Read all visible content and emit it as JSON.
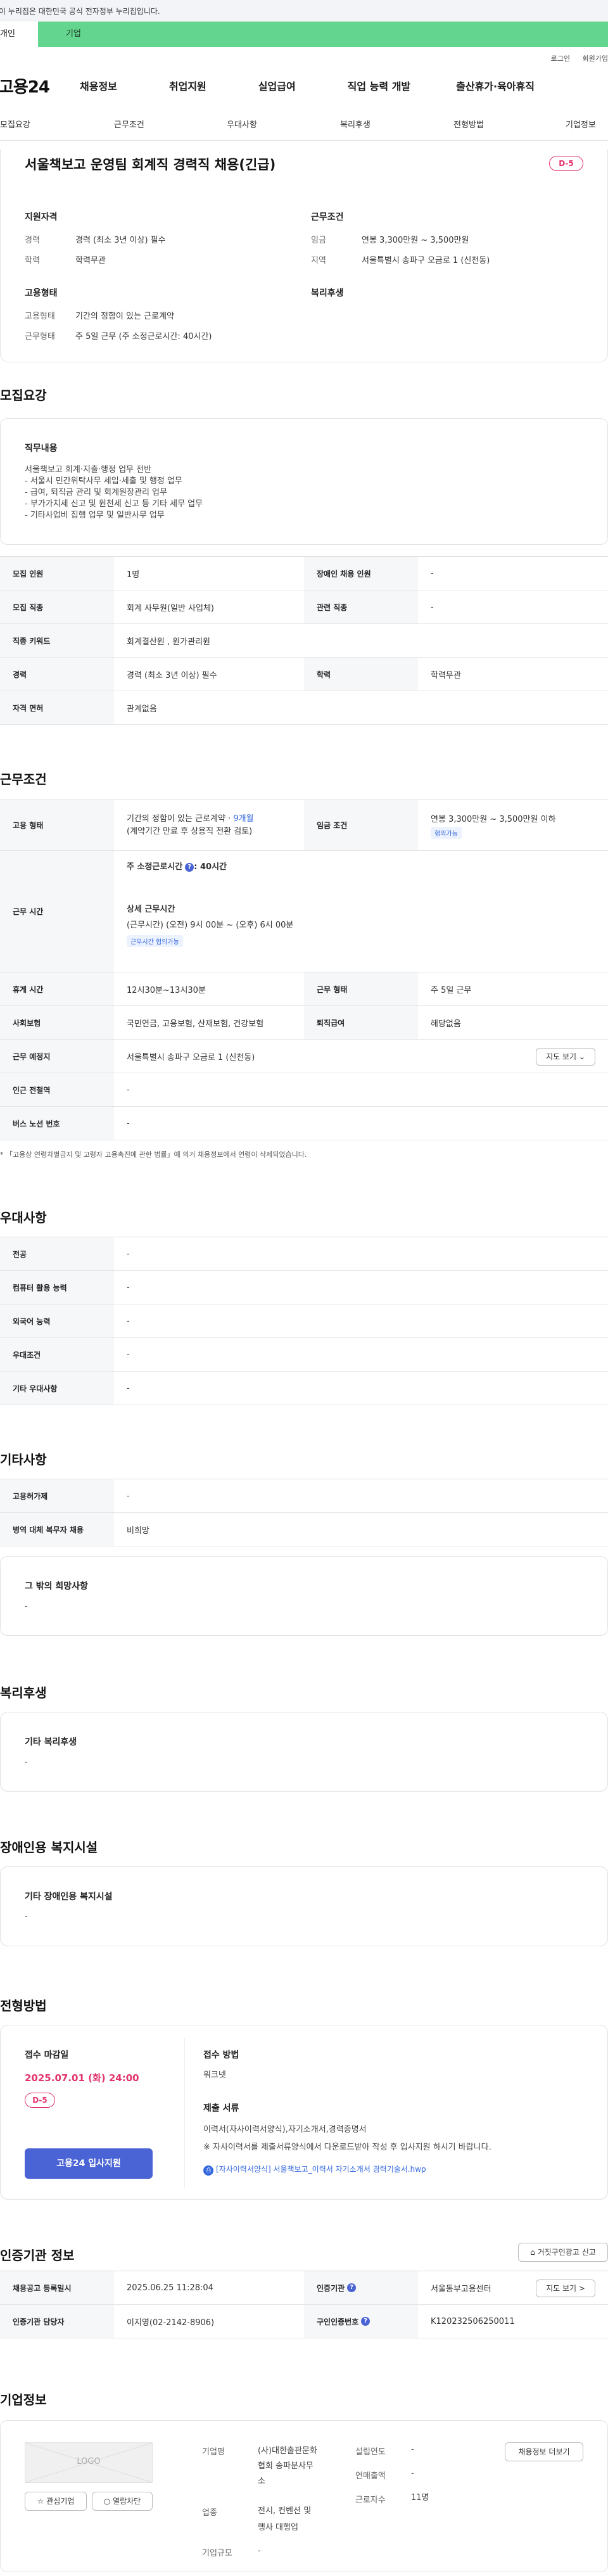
{
  "gov_banner": "이 누리집은 대한민국 공식 전자정부 누리집입니다.",
  "tabs": {
    "personal": "개인",
    "corp": "기업"
  },
  "util": {
    "login": "로그인",
    "join": "회원가입"
  },
  "logo": "고용24",
  "gnb": [
    "채용정보",
    "취업지원",
    "실업급여",
    "직업 능력 개발",
    "출산휴가·육아휴직"
  ],
  "anchors": [
    "모집요강",
    "근무조건",
    "우대사항",
    "복리후생",
    "전형방법",
    "기업정보"
  ],
  "summary": {
    "title": "서울책보고 운영팀 회계직 경력직 채용(긴급)",
    "dday": "D-5",
    "qual_head": "지원자격",
    "career_label": "경력",
    "career_val": "경력 (최소 3년 이상) 필수",
    "edu_label": "학력",
    "edu_val": "학력무관",
    "cond_head": "근무조건",
    "wage_label": "임금",
    "wage_val": "연봉 3,300만원 ~ 3,500만원",
    "region_label": "지역",
    "region_val": "서울특별시 송파구 오금로 1 (신천동)",
    "emp_head": "고용형태",
    "emptype_label": "고용형태",
    "emptype_val": "기간의 정함이 있는 근로계약",
    "hours_label": "근무형태",
    "hours_val": "주 5일 근무 (주 소정근로시간: 40시간)",
    "welfare_head": "복리후생"
  },
  "recruit": {
    "title": "모집요강",
    "duty_head": "직무내용",
    "duty_lines": [
      "서울책보고 회계·지출·행정 업무 전반",
      "- 서울시 민간위탁사무 세입·세출 및 행정 업무",
      "- 급여, 퇴직금 관리 및 회계원장관리 업무",
      "- 부가가치세 신고 및 원천세 신고 등 기타 세무 업무",
      "- 기타사업비 집행 업무 및 일반사무 업무"
    ],
    "rows": [
      {
        "l1": "모집 인원",
        "v1": "1명",
        "l2": "장애인 채용 인원",
        "v2": "-"
      },
      {
        "l1": "모집 직종",
        "v1": "회계 사무원(일반 사업체)",
        "l2": "관련 직종",
        "v2": "-"
      },
      {
        "l1": "직종 키워드",
        "v1": "회계결산원 , 원가관리원"
      },
      {
        "l1": "경력",
        "v1": "경력 (최소 3년 이상) 필수",
        "l2": "학력",
        "v2": "학력무관"
      },
      {
        "l1": "자격 면허",
        "v1": "관계없음"
      }
    ]
  },
  "work": {
    "title": "근무조건",
    "emptype_label": "고용 형태",
    "emptype_line1": "기간의 정함이 있는 근로계약 · ",
    "emptype_months": "9개월",
    "emptype_line2": "(계약기간 만료 후 상용직 전환 검토)",
    "wage_label": "임금 조건",
    "wage_val": "연봉 3,300만원 ~ 3,500만원 이하",
    "wage_tag": "협의가능",
    "hours_label": "근무 시간",
    "week_hours": "주 소정근로시간",
    "week_hours_val": ": 40시간",
    "detail_head": "상세 근무시간",
    "detail_val": "(근무시간) (오전) 9시 00분 ~ (오후) 6시 00분",
    "detail_tag": "근무시간 협의가능",
    "rest_label": "휴게 시간",
    "rest_val": "12시30분~13시30분",
    "worktype_label": "근무 형태",
    "worktype_val": "주 5일 근무",
    "ins_label": "사회보험",
    "ins_val": "국민연금, 고용보험, 산재보험, 건강보험",
    "retire_label": "퇴직급여",
    "retire_val": "해당없음",
    "place_label": "근무 예정지",
    "place_val": "서울특별시 송파구 오금로 1 (신천동)",
    "map_btn": "지도 보기 ⌄",
    "subway_label": "인근 전철역",
    "subway_val": "-",
    "bus_label": "버스 노선 번호",
    "bus_val": "-",
    "footnote": "* 「고용상 연령차별금지 및 고령자 고용촉진에 관한 법률」에 의거 채용정보에서 연령이 삭제되었습니다."
  },
  "pref": {
    "title": "우대사항",
    "rows": [
      {
        "label": "전공",
        "val": "-"
      },
      {
        "label": "컴퓨터 활용 능력",
        "val": "-"
      },
      {
        "label": "외국어 능력",
        "val": "-"
      },
      {
        "label": "우대조건",
        "val": "-"
      },
      {
        "label": "기타 우대사항",
        "val": "-"
      }
    ]
  },
  "etc": {
    "title": "기타사항",
    "rows": [
      {
        "label": "고용허가제",
        "val": "-"
      },
      {
        "label": "병역 대체 복무자 채용",
        "val": "비희망"
      }
    ],
    "wish_head": "그 밖의 희망사항",
    "wish_val": "-"
  },
  "welfare": {
    "title": "복리후생",
    "head": "기타 복리후생",
    "val": "-"
  },
  "disabled": {
    "title": "장애인용 복지시설",
    "head": "기타 장애인용 복지시설",
    "val": "-"
  },
  "process": {
    "title": "전형방법",
    "deadline_head": "접수 마감일",
    "deadline": "2025.07.01 (화) 24:00",
    "dday": "D-5",
    "apply_btn": "고용24 입사지원",
    "method_head": "접수 방법",
    "method_val": "워크넷",
    "docs_head": "제출 서류",
    "docs_line1": "이력서(자사이력서양식),자기소개서,경력증명서",
    "docs_line2": "※ 자사이력서를 제출서류양식에서 다운로드받아 작성 후 입사지원 하시기 바랍니다.",
    "attach": "[자사이력서양식] 서울책보고_이력서 자기소개서 경력기술서.hwp"
  },
  "cert": {
    "title": "인증기관 정보",
    "report_btn": "거짓구인광고 신고",
    "reg_label": "채용공고 등록일시",
    "reg_val": "2025.06.25 11:28:04",
    "org_label": "인증기관",
    "org_val": "서울동부고용센터",
    "map_btn": "지도 보기 >",
    "mgr_label": "인증기관 담당자",
    "mgr_val": "이지영(02-2142-8906)",
    "no_label": "구인인증번호",
    "no_val": "K120232506250011"
  },
  "company": {
    "title": "기업정보",
    "logo_text": "LOGO",
    "fav_btn": "☆ 관심기업",
    "block_btn": "○ 열람차단",
    "name_label": "기업명",
    "name_val": [
      "(사)대한출판문화",
      "협회 송파분사무",
      "소"
    ],
    "industry_label": "업종",
    "industry_val": [
      "전시, 컨벤션 및",
      "행사 대행업"
    ],
    "scale_label": "기업규모",
    "scale_val": "-",
    "founded_label": "설립연도",
    "founded_val": "-",
    "sales_label": "연매출액",
    "sales_val": "-",
    "staff_label": "근로자수",
    "staff_val": "11명",
    "more_btn": "채용정보 더보기"
  }
}
